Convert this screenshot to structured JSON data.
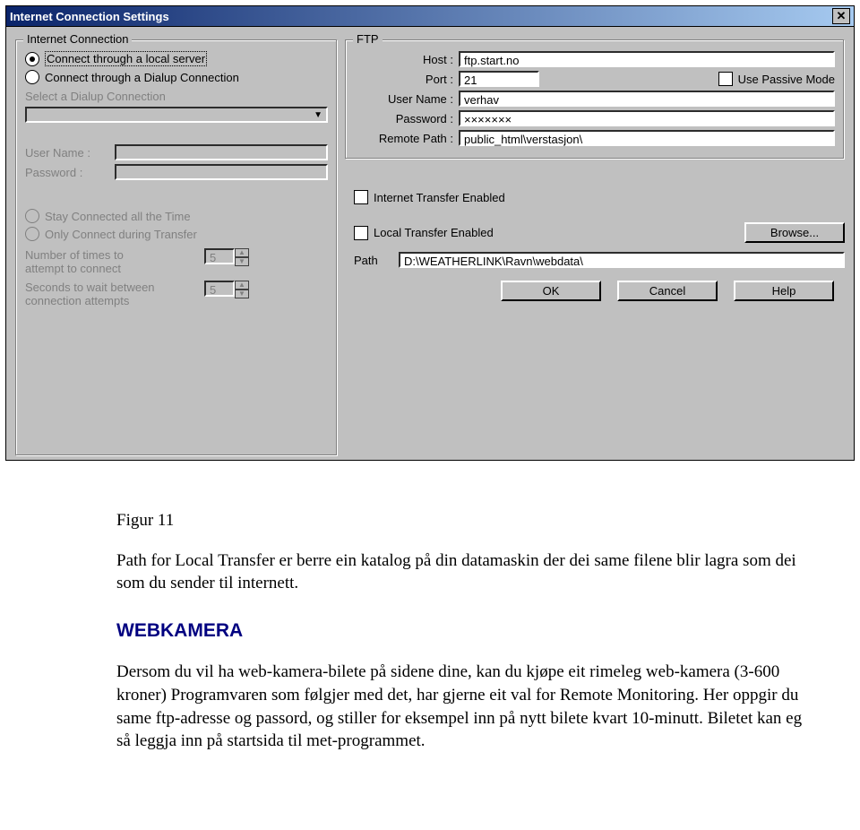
{
  "dialog": {
    "title": "Internet Connection Settings",
    "close_glyph": "✕",
    "left": {
      "group_title": "Internet Connection",
      "radio_local": "Connect through a local server",
      "radio_dialup": "Connect through a Dialup Connection",
      "select_dialup_label": "Select a Dialup Connection",
      "dialup_value": "",
      "user_label": "User Name :",
      "user_value": "",
      "pass_label": "Password :",
      "pass_value": "",
      "radio_stay": "Stay Connected all the Time",
      "radio_only": "Only Connect during Transfer",
      "attempts_label1": "Number of times to",
      "attempts_label2": "attempt to connect",
      "attempts_value": "5",
      "wait_label1": "Seconds to wait between",
      "wait_label2": "connection attempts",
      "wait_value": "5"
    },
    "ftp": {
      "group_title": "FTP",
      "host_label": "Host :",
      "host_value": "ftp.start.no",
      "port_label": "Port :",
      "port_value": "21",
      "passive_label": "Use Passive Mode",
      "user_label": "User Name :",
      "user_value": "verhav",
      "pass_label": "Password :",
      "pass_value": "×××××××",
      "remote_label": "Remote Path :",
      "remote_value": "public_html\\verstasjon\\"
    },
    "transfer": {
      "inet_label": "Internet Transfer Enabled",
      "local_label": "Local Transfer Enabled",
      "browse": "Browse...",
      "path_label": "Path",
      "path_value": "D:\\WEATHERLINK\\Ravn\\webdata\\"
    },
    "buttons": {
      "ok": "OK",
      "cancel": "Cancel",
      "help": "Help"
    }
  },
  "doc": {
    "caption": "Figur 11",
    "para1": "Path for Local Transfer er berre ein katalog på din datamaskin der dei same filene blir lagra som dei som du sender til internett.",
    "heading": "WEBKAMERA",
    "para2": "Dersom du vil ha web-kamera-bilete på sidene dine, kan du kjøpe eit rimeleg web-kamera (3-600 kroner) Programvaren som følgjer med det, har gjerne eit val for Remote Monitoring. Her oppgir du same ftp-adresse og passord, og stiller for eksempel inn på nytt bilete kvart 10-minutt. Biletet kan eg så leggja inn på startsida til met-programmet."
  }
}
